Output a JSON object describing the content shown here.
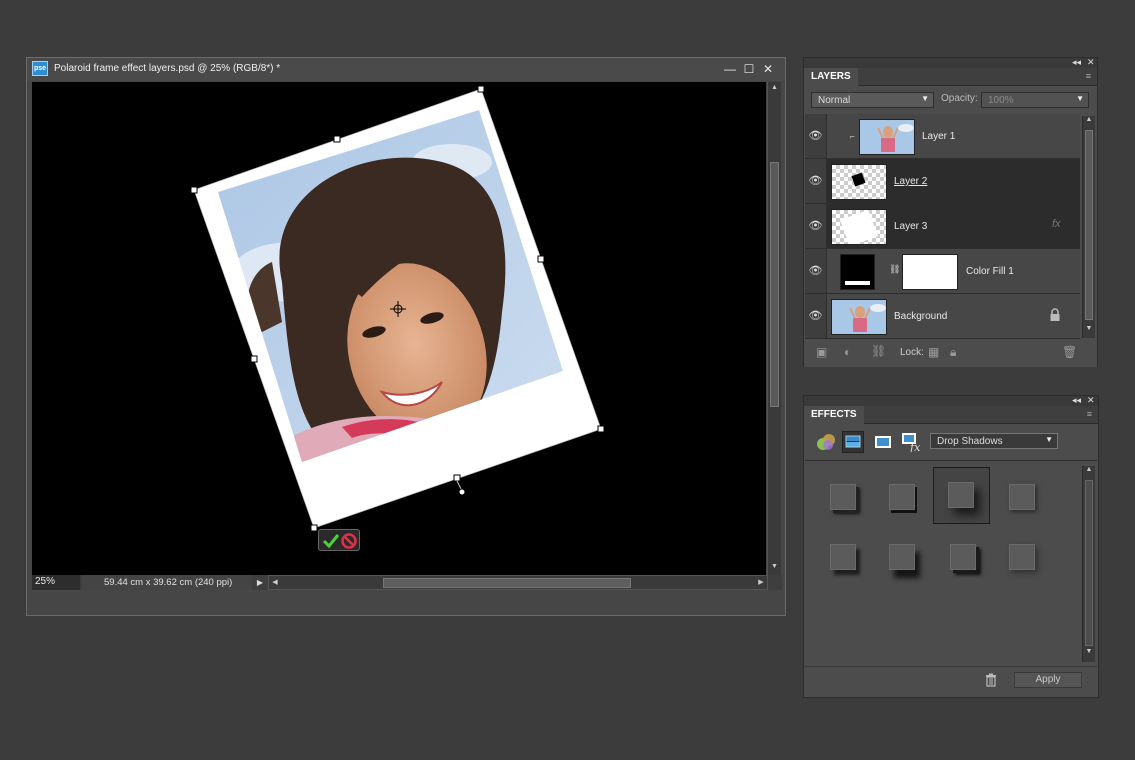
{
  "document": {
    "title": "Polaroid frame effect layers.psd @ 25% (RGB/8*) *",
    "app_badge": "pse",
    "zoom": "25%",
    "size_info": "59.44 cm x 39.62 cm (240 ppi)",
    "buttons": {
      "minimize": "—",
      "maximize": "☐",
      "close": "✕"
    }
  },
  "layers_panel": {
    "tab": "LAYERS",
    "blend_mode": "Normal",
    "opacity_label": "Opacity:",
    "opacity_value": "100%",
    "lock_label": "Lock:",
    "layers": [
      {
        "name": "Layer 1",
        "thumb": "photo"
      },
      {
        "name": "Layer 2",
        "thumb": "checker-black-square"
      },
      {
        "name": "Layer 3",
        "thumb": "checker-white"
      },
      {
        "name": "Color Fill 1",
        "thumb": "fill-black-mask-white"
      },
      {
        "name": "Background",
        "thumb": "photo"
      }
    ]
  },
  "effects_panel": {
    "tab": "EFFECTS",
    "category": "Drop Shadows",
    "apply_label": "Apply"
  },
  "icons": {
    "eye": "eye-icon",
    "lock": "lock-icon",
    "trash": "trash-icon",
    "commit": "check-icon",
    "cancel": "cancel-icon"
  }
}
